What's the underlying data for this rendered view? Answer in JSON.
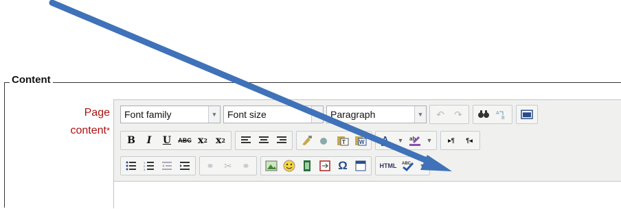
{
  "fieldset": {
    "legend": "Content",
    "label": "Page",
    "label_line2": "content",
    "required_mark": "*"
  },
  "editor": {
    "font_family": "Font family",
    "font_size": "Font size",
    "format": "Paragraph",
    "html_button": "HTML",
    "spell_label": "ABC"
  },
  "colors": {
    "label": "#aa1111",
    "arrow": "#3f72b8",
    "toolbar_bg": "#f0f0ee"
  }
}
